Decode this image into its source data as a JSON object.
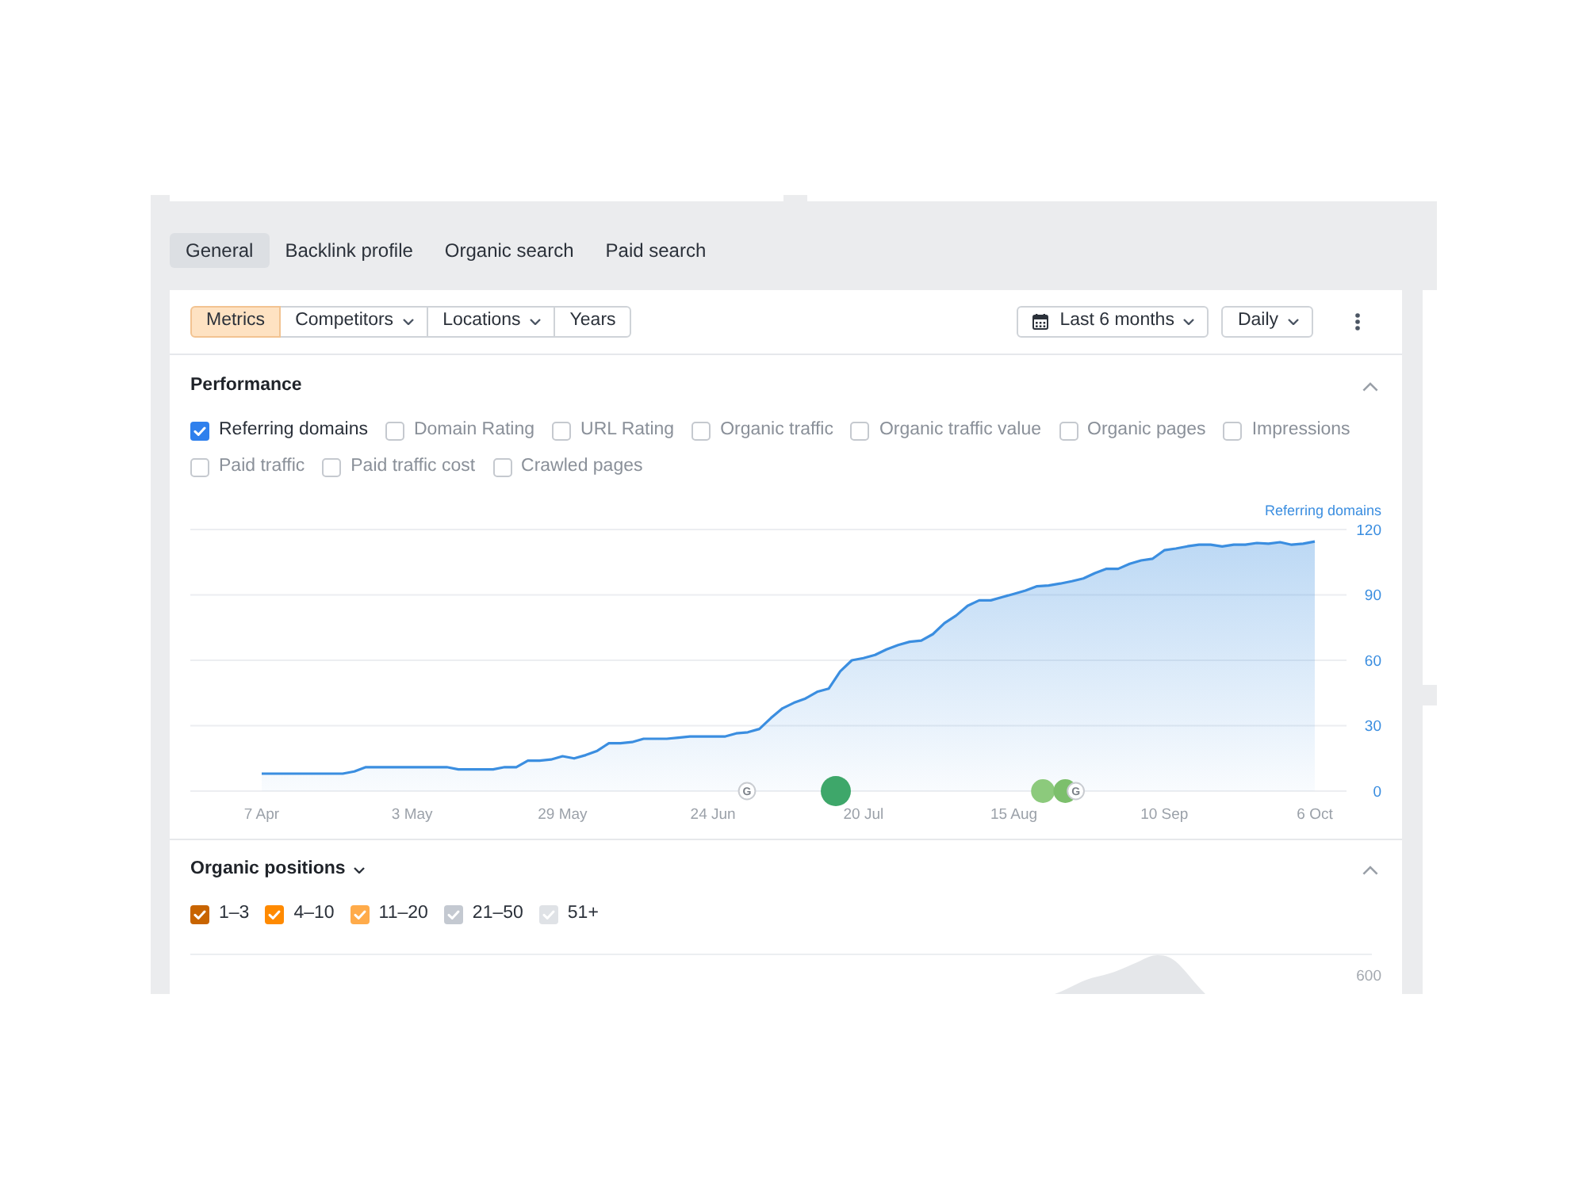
{
  "tabs": [
    {
      "label": "General",
      "selected": true
    },
    {
      "label": "Backlink profile",
      "selected": false
    },
    {
      "label": "Organic search",
      "selected": false
    },
    {
      "label": "Paid search",
      "selected": false
    }
  ],
  "toolbar": {
    "views": [
      {
        "label": "Metrics",
        "kind": "toggle",
        "selected": true
      },
      {
        "label": "Competitors",
        "kind": "dropdown",
        "selected": false
      },
      {
        "label": "Locations",
        "kind": "dropdown",
        "selected": false
      },
      {
        "label": "Years",
        "kind": "toggle",
        "selected": false
      }
    ],
    "date_range": "Last 6 months",
    "interval": "Daily"
  },
  "performance": {
    "title": "Performance",
    "expanded": true,
    "metrics": [
      {
        "label": "Referring domains",
        "checked": true
      },
      {
        "label": "Domain Rating",
        "checked": false
      },
      {
        "label": "URL Rating",
        "checked": false
      },
      {
        "label": "Organic traffic",
        "checked": false
      },
      {
        "label": "Organic traffic value",
        "checked": false
      },
      {
        "label": "Organic pages",
        "checked": false
      },
      {
        "label": "Impressions",
        "checked": false
      },
      {
        "label": "Paid traffic",
        "checked": false
      },
      {
        "label": "Paid traffic cost",
        "checked": false
      },
      {
        "label": "Crawled pages",
        "checked": false
      }
    ],
    "chart_data": {
      "type": "area",
      "categories": [
        "7 Apr",
        null,
        null,
        null,
        null,
        null,
        null,
        null,
        null,
        null,
        null,
        null,
        null,
        "3 May",
        null,
        null,
        null,
        null,
        null,
        null,
        null,
        null,
        null,
        null,
        null,
        null,
        "29 May",
        null,
        null,
        null,
        null,
        null,
        null,
        null,
        null,
        null,
        null,
        null,
        null,
        "24 Jun",
        null,
        null,
        null,
        null,
        null,
        null,
        null,
        null,
        null,
        null,
        null,
        null,
        "20 Jul",
        null,
        null,
        null,
        null,
        null,
        null,
        null,
        null,
        null,
        null,
        null,
        null,
        "15 Aug",
        null,
        null,
        null,
        null,
        null,
        null,
        null,
        null,
        null,
        null,
        null,
        null,
        "10 Sep",
        null,
        null,
        null,
        null,
        null,
        null,
        null,
        null,
        null,
        null,
        null,
        null,
        "6 Oct"
      ],
      "series": [
        {
          "name": "Referring domains",
          "color": "#3b8ee0",
          "values": [
            8,
            8,
            8,
            8,
            8,
            8,
            8,
            8,
            9,
            11,
            11,
            11,
            11,
            11,
            11,
            11,
            11,
            10,
            10,
            10,
            10,
            11,
            11,
            14,
            14,
            14.5,
            16,
            15,
            16.5,
            18.5,
            22,
            22,
            22.5,
            24,
            24,
            24,
            24.5,
            25,
            25,
            25,
            25,
            26.5,
            27,
            28.5,
            33.5,
            38,
            40.5,
            42.5,
            45.5,
            47,
            55,
            60,
            61,
            62.5,
            65,
            67,
            68.5,
            69,
            72,
            77,
            80.5,
            85,
            87.5,
            87.5,
            89,
            90.5,
            92,
            94,
            94.3,
            95.2,
            96.3,
            97.5,
            100,
            102,
            102,
            104.3,
            105.8,
            106.6,
            110.5,
            111.3,
            112.3,
            113,
            113,
            112.2,
            113,
            113,
            113.8,
            113.5,
            114.2,
            113,
            113.5,
            114.5
          ]
        }
      ],
      "ylim": [
        0,
        120
      ],
      "yticks": [
        0,
        30,
        60,
        90,
        120
      ],
      "grid": true
    },
    "markers": [
      {
        "kind": "update",
        "label": "G"
      },
      {
        "kind": "major",
        "color": "#3ea76a"
      },
      {
        "kind": "minor",
        "color": "#8cca7c"
      },
      {
        "kind": "minor",
        "color": "#7cbf6c"
      },
      {
        "kind": "update",
        "label": "G"
      }
    ]
  },
  "organic_positions": {
    "title": "Organic positions",
    "expanded": true,
    "positions": [
      {
        "label": "1–3",
        "checked": true,
        "color": "#c86400"
      },
      {
        "label": "4–10",
        "checked": true,
        "color": "#ff8a00"
      },
      {
        "label": "11–20",
        "checked": true,
        "color": "#ffab4a"
      },
      {
        "label": "21–50",
        "checked": true,
        "color": "#c4c9d1"
      },
      {
        "label": "51+",
        "checked": true,
        "color": "#dfe2e6"
      }
    ],
    "axis_label": "600"
  }
}
